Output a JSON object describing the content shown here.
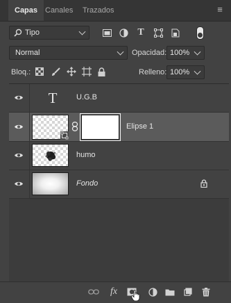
{
  "tabs": [
    {
      "label": "Capas"
    },
    {
      "label": "Canales"
    },
    {
      "label": "Trazados"
    }
  ],
  "filter": {
    "kind_value": "Tipo"
  },
  "blend": {
    "mode_value": "Normal",
    "opacity_label": "Opacidad:",
    "opacity_value": "100%"
  },
  "lock": {
    "label": "Bloq.:",
    "fill_label": "Relleno:",
    "fill_value": "100%"
  },
  "layers": [
    {
      "name": "U.G.B",
      "type": "text"
    },
    {
      "name": "Elipse 1",
      "type": "masked",
      "selected": true
    },
    {
      "name": "humo",
      "type": "pixel"
    },
    {
      "name": "Fondo",
      "type": "background",
      "locked": true
    }
  ],
  "colors": {
    "panel_bg": "#424242",
    "selected_row": "#5b5b5b",
    "tab_bar": "#353535"
  }
}
